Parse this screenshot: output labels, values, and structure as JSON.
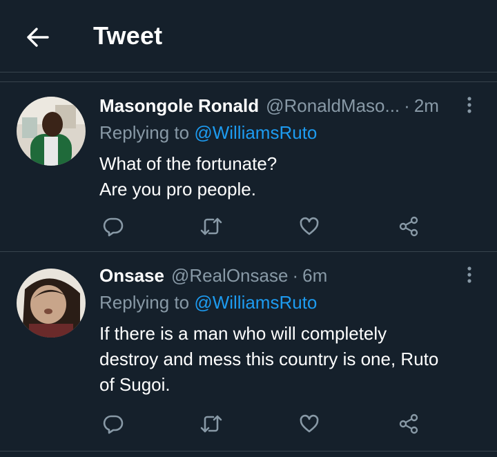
{
  "header": {
    "title": "Tweet"
  },
  "tweets": [
    {
      "name": "Masongole Ronald",
      "handle": "@RonaldMaso...",
      "separator": "·",
      "time": "2m",
      "replying_prefix": "Replying to ",
      "replying_to": "@WilliamsRuto",
      "lines": [
        "What of the fortunate?",
        "Are you pro people."
      ]
    },
    {
      "name": "Onsase",
      "handle": "@RealOnsase",
      "separator": "·",
      "time": "6m",
      "replying_prefix": "Replying to ",
      "replying_to": "@WilliamsRuto",
      "lines": [
        "If there is a man who will completely",
        "destroy and mess this country is one, Ruto",
        "of Sugoi."
      ]
    }
  ],
  "colors": {
    "background": "#15202b",
    "divider": "#38444d",
    "secondary_text": "#8899a6",
    "link": "#1d9bf0"
  },
  "icons": [
    "back-arrow-icon",
    "more-vertical-icon",
    "reply-icon",
    "retweet-icon",
    "like-icon",
    "share-icon"
  ]
}
